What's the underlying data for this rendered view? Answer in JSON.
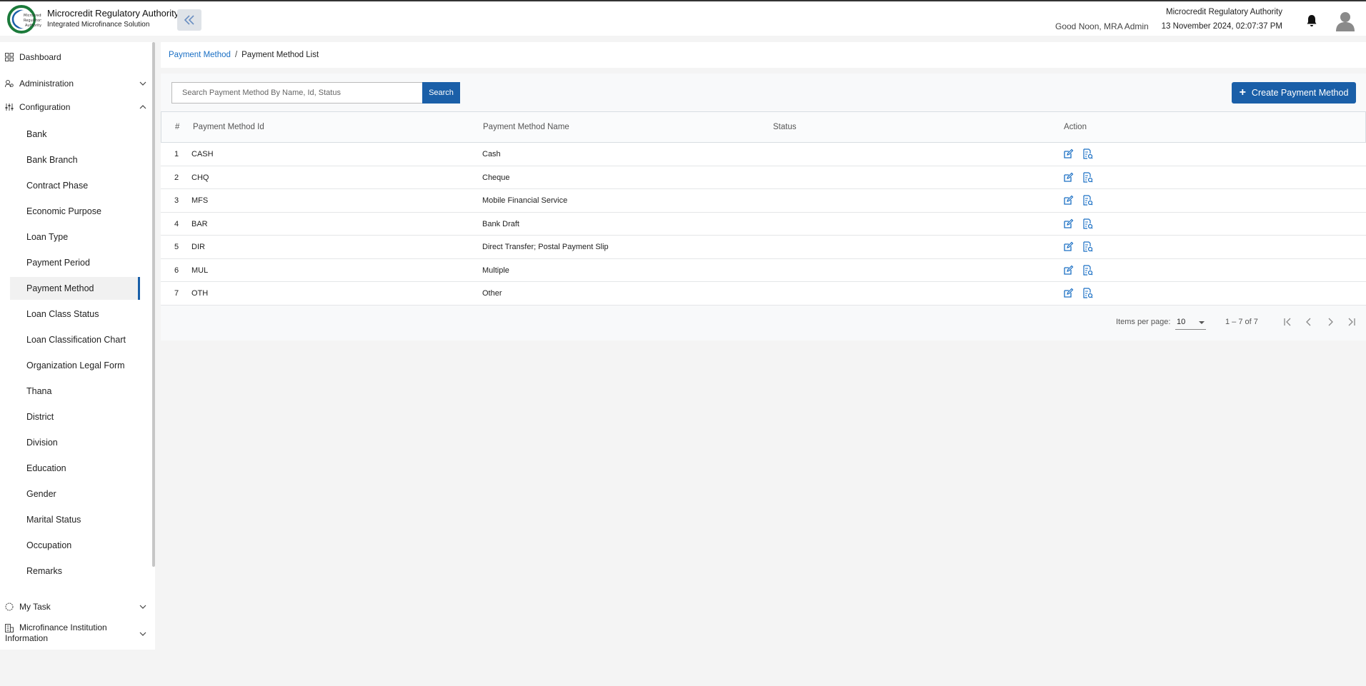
{
  "header": {
    "logo_text": "Microcredit Regulatory Authority",
    "title": "Microcredit Regulatory Authority",
    "subtitle": "Integrated Microfinance Solution",
    "greeting": "Good Noon, MRA Admin",
    "org_name": "Microcredit Regulatory Authority",
    "datetime": "13 November 2024, 02:07:37 PM",
    "icons": [
      "double-chevron-left-icon",
      "bell-icon",
      "user-avatar-icon"
    ]
  },
  "sidebar": {
    "dashboard": "Dashboard",
    "administration": "Administration",
    "configuration": "Configuration",
    "config_items": [
      "Bank",
      "Bank Branch",
      "Contract Phase",
      "Economic Purpose",
      "Loan Type",
      "Payment Period",
      "Payment Method",
      "Loan Class Status",
      "Loan Classification Chart",
      "Organization Legal Form",
      "Thana",
      "District",
      "Division",
      "Education",
      "Gender",
      "Marital Status",
      "Occupation",
      "Remarks"
    ],
    "active_item": "Payment Method",
    "my_task": "My Task",
    "mfi_info": "Microfinance Institution Information"
  },
  "breadcrumb": {
    "parent": "Payment Method",
    "separator": "/",
    "current": "Payment Method List"
  },
  "toolbar": {
    "search_placeholder": "Search Payment Method By Name, Id, Status",
    "search_label": "Search",
    "create_label": "Create Payment Method"
  },
  "table": {
    "headers": [
      "#",
      "Payment Method Id",
      "Payment Method Name",
      "Status",
      "Action"
    ],
    "rows": [
      {
        "num": "1",
        "id": "CASH",
        "name": "Cash",
        "status": ""
      },
      {
        "num": "2",
        "id": "CHQ",
        "name": "Cheque",
        "status": ""
      },
      {
        "num": "3",
        "id": "MFS",
        "name": "Mobile Financial Service",
        "status": ""
      },
      {
        "num": "4",
        "id": "BAR",
        "name": "Bank Draft",
        "status": ""
      },
      {
        "num": "5",
        "id": "DIR",
        "name": "Direct Transfer; Postal Payment Slip",
        "status": ""
      },
      {
        "num": "6",
        "id": "MUL",
        "name": "Multiple",
        "status": ""
      },
      {
        "num": "7",
        "id": "OTH",
        "name": "Other",
        "status": ""
      }
    ]
  },
  "paginator": {
    "items_per_page_label": "Items per page:",
    "items_per_page": "10",
    "range": "1 – 7 of 7"
  },
  "colors": {
    "primary": "#1a5fa8",
    "link": "#1a6fc4",
    "icon": "#1a6fc4"
  }
}
